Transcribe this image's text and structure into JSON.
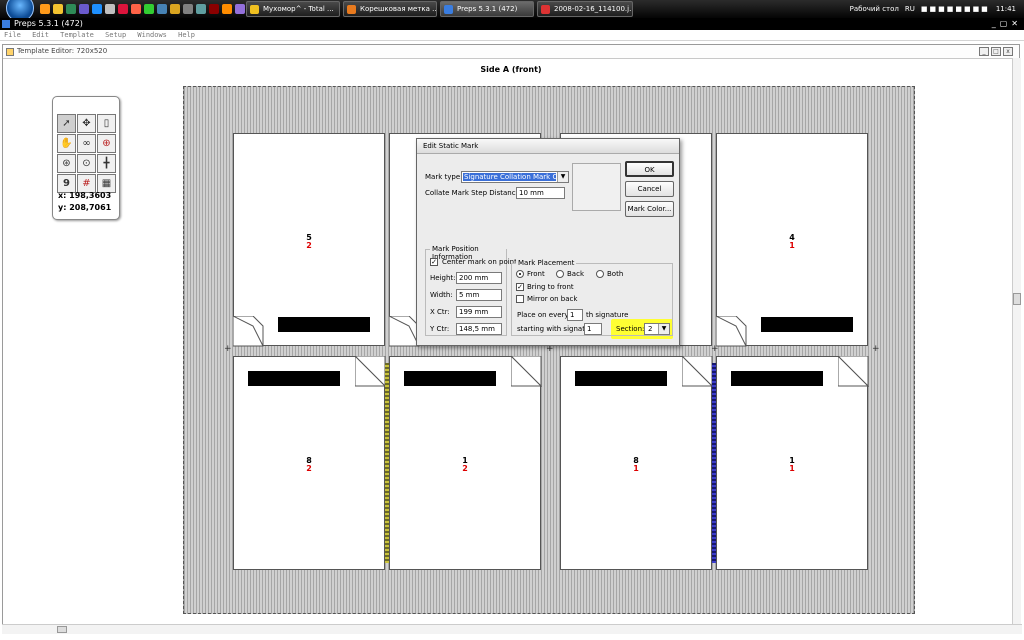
{
  "taskbar": {
    "buttons": [
      {
        "label": "Мухомор^ - Total ...",
        "active": false
      },
      {
        "label": "Корешковая метка ...",
        "active": false
      },
      {
        "label": "Preps 5.3.1 (472)",
        "active": true
      },
      {
        "label": "2008-02-16_114100.j...",
        "active": false
      }
    ],
    "desktop_label": "Рабочий стол",
    "language": "RU",
    "clock": "11:41"
  },
  "app": {
    "title": "Preps 5.3.1 (472)"
  },
  "menu": [
    "File",
    "Edit",
    "Template",
    "Setup",
    "Windows",
    "Help"
  ],
  "document": {
    "title": "Template Editor: 720x520",
    "side_header": "Side A (front)"
  },
  "pages": [
    {
      "top": "5",
      "bottom": "2"
    },
    {
      "top": "4",
      "bottom": "1"
    },
    {
      "top": "8",
      "bottom": "2"
    },
    {
      "top": "1",
      "bottom": "2"
    },
    {
      "top": "8",
      "bottom": "1"
    },
    {
      "top": "1",
      "bottom": "1"
    }
  ],
  "tools_palette": {
    "x_readout": "x: 198,3603",
    "y_readout": "y: 208,7061",
    "icons": [
      "arrow-pointer-icon",
      "move-icon",
      "page-icon",
      "hand-icon",
      "glasses-icon",
      "crosshair-icon",
      "zoom-in-icon",
      "zoom-out-icon",
      "grid-split-icon",
      "nine-up-icon",
      "grid-icon",
      "layout-icon"
    ],
    "tool9_label": "9"
  },
  "dialog": {
    "title": "Edit Static Mark",
    "mark_type_label": "Mark type:",
    "mark_type_value": "Signature Collation Mark C",
    "step_label": "Collate Mark Step Distance:",
    "step_value": "10 mm",
    "buttons": {
      "ok": "OK",
      "cancel": "Cancel",
      "mark_color": "Mark Color..."
    },
    "position_group": {
      "title": "Mark Position Information",
      "center_label": "Center mark on point",
      "height_label": "Height:",
      "height_value": "200 mm",
      "width_label": "Width:",
      "width_value": "5 mm",
      "xctr_label": "X Ctr:",
      "xctr_value": "199 mm",
      "yctr_label": "Y Ctr:",
      "yctr_value": "148,5 mm"
    },
    "placement_group": {
      "title": "Mark Placement",
      "front": "Front",
      "back": "Back",
      "both": "Both",
      "bring_to_front": "Bring to front",
      "mirror_on_back": "Mirror on back",
      "place_every_label": "Place on every",
      "place_every_value": "1",
      "th_signature": "th signature",
      "starting_label": "starting with signature",
      "starting_value": "1",
      "section_label": "Section:",
      "section_value": "2"
    }
  }
}
